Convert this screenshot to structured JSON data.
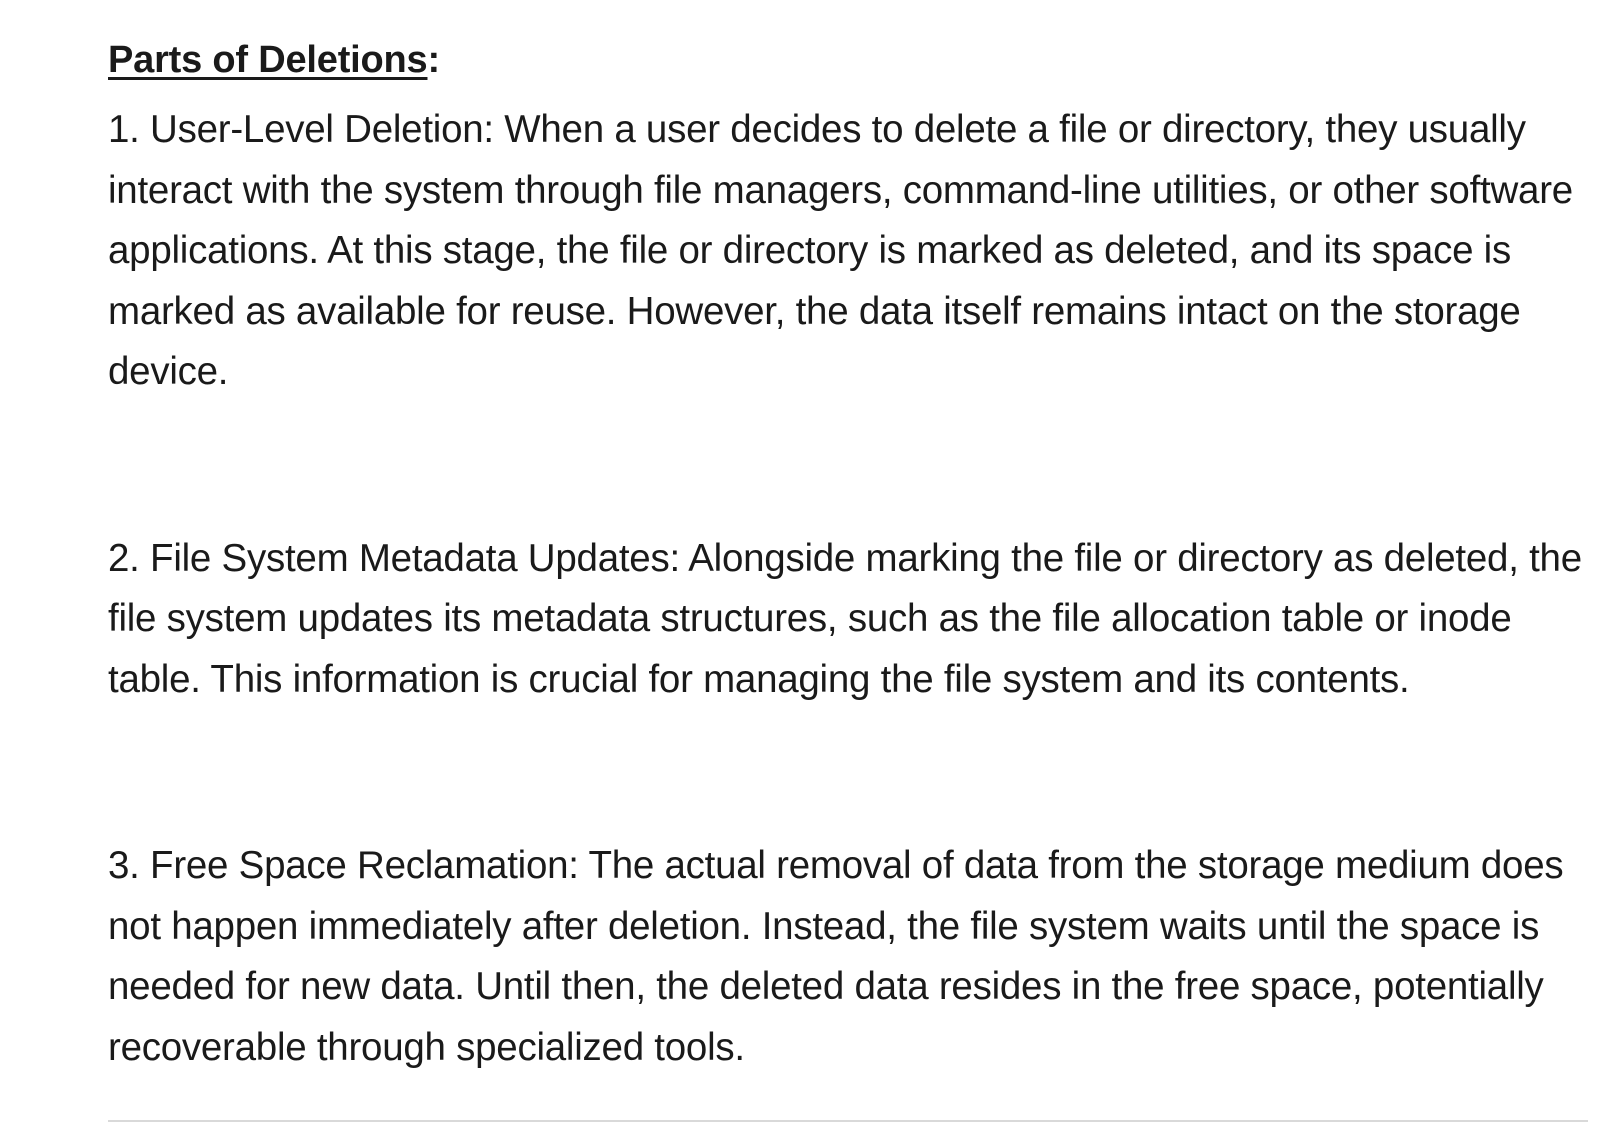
{
  "heading": {
    "title": "Parts of Deletions",
    "colon": ":"
  },
  "items": [
    {
      "text": "1. User-Level Deletion: When a user decides to delete a file or directory, they usually interact with the system through file managers, command-line utilities, or other software applications. At this stage, the file or directory is marked as deleted, and its space is marked as available for reuse. However, the data itself remains intact on the storage device."
    },
    {
      "text": "2. File System Metadata Updates: Alongside marking the file or directory as deleted, the file system updates its metadata structures, such as the file allocation table or inode table. This information is crucial for managing the file system and its contents."
    },
    {
      "text": "3. Free Space Reclamation: The actual removal of data from the storage medium does not happen immediately after deletion. Instead, the file system waits until the space is needed for new data. Until then, the deleted data resides in the free space, potentially recoverable through specialized tools."
    }
  ]
}
